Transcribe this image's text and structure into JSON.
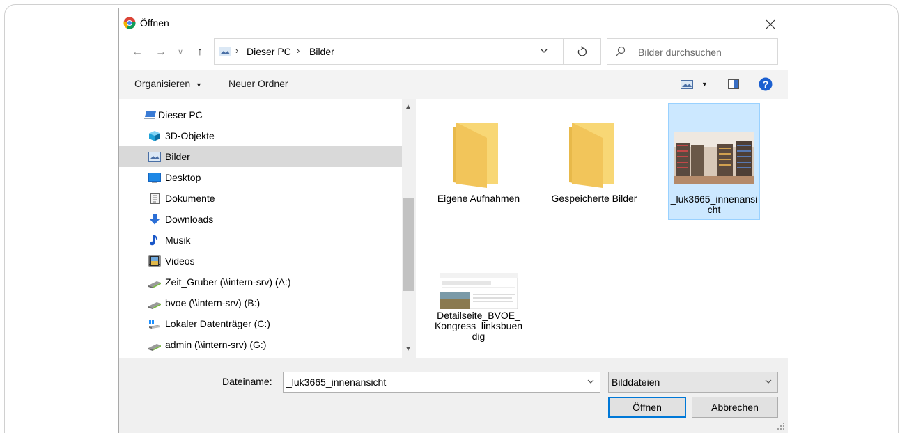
{
  "dialog": {
    "title": "Öffnen"
  },
  "address": {
    "crumbs": [
      "Dieser PC",
      "Bilder"
    ]
  },
  "search": {
    "placeholder": "Bilder durchsuchen"
  },
  "toolbar": {
    "organize_label": "Organisieren",
    "new_folder_label": "Neuer Ordner"
  },
  "nav": {
    "items": [
      {
        "label": "Dieser PC",
        "icon": "computer-icon"
      },
      {
        "label": "3D-Objekte",
        "icon": "cube-icon"
      },
      {
        "label": "Bilder",
        "icon": "pictures-icon",
        "selected": true
      },
      {
        "label": "Desktop",
        "icon": "desktop-icon"
      },
      {
        "label": "Dokumente",
        "icon": "document-icon"
      },
      {
        "label": "Downloads",
        "icon": "download-arrow-icon"
      },
      {
        "label": "Musik",
        "icon": "music-note-icon"
      },
      {
        "label": "Videos",
        "icon": "film-icon"
      },
      {
        "label": "Zeit_Gruber (\\\\intern-srv) (A:)",
        "icon": "network-drive-icon"
      },
      {
        "label": "bvoe (\\\\intern-srv) (B:)",
        "icon": "network-drive-icon"
      },
      {
        "label": "Lokaler Datenträger (C:)",
        "icon": "local-drive-icon"
      },
      {
        "label": "admin (\\\\intern-srv) (G:)",
        "icon": "network-drive-icon"
      }
    ]
  },
  "files": [
    {
      "name": "Eigene Aufnahmen",
      "kind": "folder"
    },
    {
      "name": "Gespeicherte Bilder",
      "kind": "folder"
    },
    {
      "name": "_luk3665_innenansicht",
      "kind": "image",
      "selected": true
    },
    {
      "name": "Detailseite_BVOE_Kongress_linksbuendig",
      "kind": "image"
    }
  ],
  "bottom": {
    "filename_label": "Dateiname:",
    "filename_value": "_luk3665_innenansicht",
    "filetype_value": "Bilddateien",
    "open_label": "Öffnen",
    "cancel_label": "Abbrechen"
  },
  "colors": {
    "accent": "#0078d7",
    "selection": "#cce8ff",
    "folder": "#f8d775"
  }
}
